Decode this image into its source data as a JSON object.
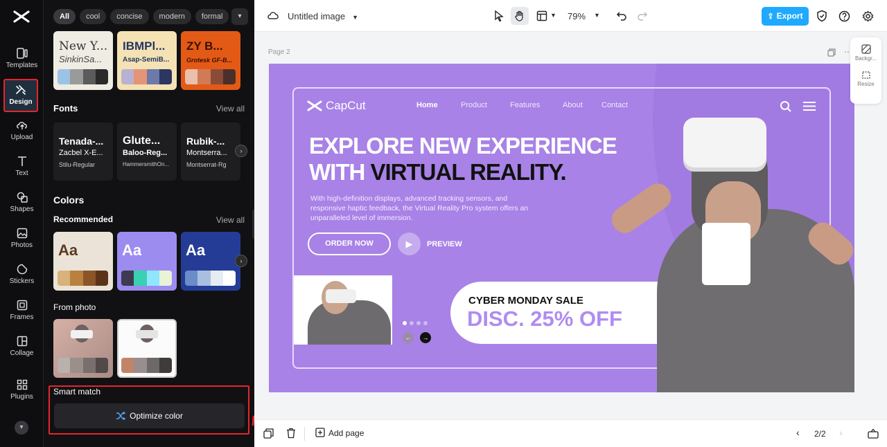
{
  "colors": {
    "accent": "#1fa9ff",
    "highlight": "#e6252c",
    "slide_bg": "#a882e6",
    "sale_text": "#b08cf0"
  },
  "rail": {
    "items": [
      {
        "label": "Templates",
        "icon": "templates-icon"
      },
      {
        "label": "Design",
        "icon": "design-icon"
      },
      {
        "label": "Upload",
        "icon": "upload-icon"
      },
      {
        "label": "Text",
        "icon": "text-icon"
      },
      {
        "label": "Shapes",
        "icon": "shapes-icon"
      },
      {
        "label": "Photos",
        "icon": "photos-icon"
      },
      {
        "label": "Stickers",
        "icon": "stickers-icon"
      },
      {
        "label": "Frames",
        "icon": "frames-icon"
      },
      {
        "label": "Collage",
        "icon": "collage-icon"
      },
      {
        "label": "Plugins",
        "icon": "plugins-icon"
      }
    ]
  },
  "panel": {
    "chips": [
      "All",
      "cool",
      "concise",
      "modern",
      "formal"
    ],
    "style_cards": [
      {
        "title": "New Y...",
        "subtitle": "SinkinSa...",
        "bg": "#efece3",
        "fg": "#333",
        "swatches": [
          "#9cc3e6",
          "#9a9a9a",
          "#5b5b5b",
          "#2a2a2a"
        ]
      },
      {
        "title": "IBMPl...",
        "subtitle": "Asap-SemiB...",
        "bg": "#f4e2b4",
        "fg": "#253661",
        "swatches": [
          "#b9b1d2",
          "#e49478",
          "#6b7aa8",
          "#2d3561"
        ]
      },
      {
        "title": "ZY B...",
        "subtitle": "Grotesk GF-B...",
        "bg": "#e35a16",
        "fg": "#3a1100",
        "swatches": [
          "#e8c0ac",
          "#d07b55",
          "#8b4c37",
          "#4b2f2a"
        ]
      }
    ],
    "fonts": {
      "title": "Fonts",
      "view_all": "View all",
      "cards": [
        {
          "a": "Tenada-...",
          "b": "Zacbel X-E...",
          "c": "Stilu-Regular"
        },
        {
          "a": "Glute...",
          "b": "Baloo-Reg...",
          "c": "HammersmithOn..."
        },
        {
          "a": "Rubik-...",
          "b": "Montserra...",
          "c": "Montserrat-Rg"
        }
      ]
    },
    "colors": {
      "title": "Colors",
      "recommended": "Recommended",
      "view_all": "View all",
      "cards": [
        {
          "label": "Aa",
          "bg": "#ebe3d7",
          "fg": "#5a3a20",
          "swatches": [
            "#d7b27b",
            "#b9803f",
            "#8b5527",
            "#5b3418"
          ]
        },
        {
          "label": "Aa",
          "bg": "#9c8cf0",
          "fg": "#fff",
          "swatches": [
            "#3e3a52",
            "#3ad0b4",
            "#8fe6ff",
            "#e8f2d4"
          ]
        },
        {
          "label": "Aa",
          "bg": "#253c96",
          "fg": "#fff",
          "swatches": [
            "#6a8cc8",
            "#a9bfe0",
            "#e6ecf2",
            "#ffffff"
          ]
        }
      ]
    },
    "from_photo": {
      "title": "From photo",
      "cards": [
        {
          "swatches": [
            "#b9b1ad",
            "#9b8f8a",
            "#79706d",
            "#514a49"
          ]
        },
        {
          "swatches": [
            "#c18468",
            "#9a8d8f",
            "#6e6969",
            "#3f3b3a"
          ]
        }
      ]
    },
    "smart_match": "Smart match",
    "optimize": "Optimize color"
  },
  "topbar": {
    "title": "Untitled image",
    "zoom": "79%",
    "export": "Export"
  },
  "canvas": {
    "page_label": "Page 2"
  },
  "side_widget": {
    "background": "Backgr...",
    "resize": "Resize"
  },
  "slide": {
    "logo": "CapCut",
    "nav": [
      "Home",
      "Product",
      "Features",
      "About",
      "Contact"
    ],
    "headline1": "EXPLORE NEW EXPERIENCE",
    "headline2a": "WITH ",
    "headline2b": "VIRTUAL REALITY.",
    "description": "With high-definition displays, advanced tracking sensors, and responsive haptic feedback, the Virtual Reality Pro system offers an unparalleled level of immersion.",
    "order_btn": "ORDER NOW",
    "preview": "PREVIEW",
    "sale_title": "CYBER MONDAY SALE",
    "sale_disc": "DISC. 25% OFF"
  },
  "bottombar": {
    "add_page": "Add page",
    "pager": "2/2"
  }
}
